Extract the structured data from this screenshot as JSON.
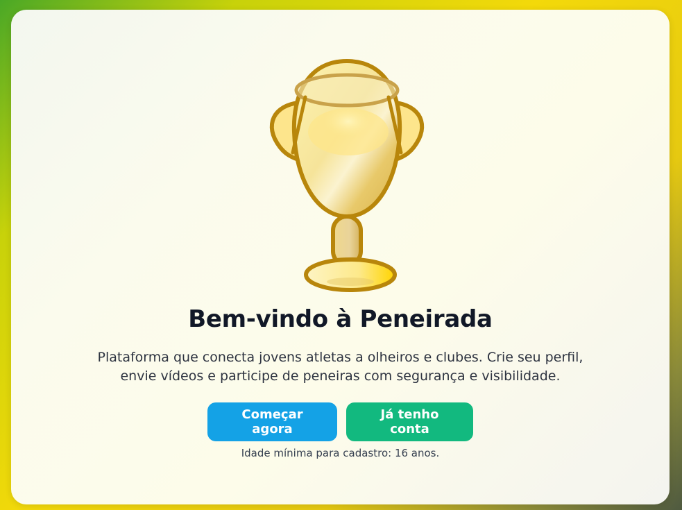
{
  "welcome": {
    "title": "Bem-vindo à Peneirada",
    "description_line1": "Plataforma que conecta jovens atletas a olheiros e clubes. Crie seu perfil,",
    "description_line2": "envie vídeos e participe de peneiras com segurança e visibilidade.",
    "primary_button": "Começar agora",
    "secondary_button": "Já tenho conta",
    "note": "Idade mínima para cadastro: 16 anos."
  },
  "illustration": {
    "icon": "trophy-icon"
  },
  "colors": {
    "primary_button": "#14a2e6",
    "secondary_button": "#12b97f",
    "trophy_outline": "#b8860b",
    "trophy_fill": "#fde68a"
  }
}
